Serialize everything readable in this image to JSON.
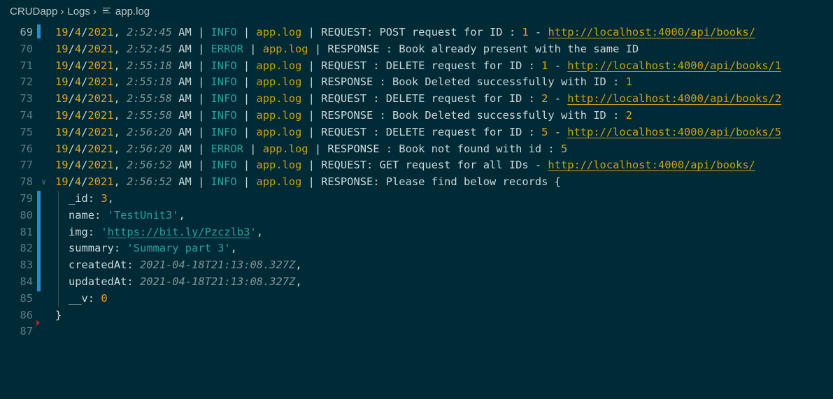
{
  "breadcrumb": {
    "project": "CRUDapp",
    "folder": "Logs",
    "file": "app.log"
  },
  "lines": [
    {
      "n": "69",
      "date": "19/4/2021",
      "time": "2:52:45",
      "ampm": "AM",
      "level": "INFO",
      "file": "app.log",
      "msg": "REQUEST: POST request for ID : ",
      "id": "1",
      "dash": " - ",
      "url": "http://localhost:4000/api/books/"
    },
    {
      "n": "70",
      "date": "19/4/2021",
      "time": "2:52:45",
      "ampm": "AM",
      "level": "ERROR",
      "file": "app.log",
      "msg": "RESPONSE : Book already present with the same ID"
    },
    {
      "n": "71",
      "date": "19/4/2021",
      "time": "2:55:18",
      "ampm": "AM",
      "level": "INFO",
      "file": "app.log",
      "msg": "REQUEST : DELETE request for ID : ",
      "id": "1",
      "dash": " - ",
      "url": "http://localhost:4000/api/books/1"
    },
    {
      "n": "72",
      "date": "19/4/2021",
      "time": "2:55:18",
      "ampm": "AM",
      "level": "INFO",
      "file": "app.log",
      "msg": "RESPONSE : Book Deleted successfully with ID : ",
      "id": "1"
    },
    {
      "n": "73",
      "date": "19/4/2021",
      "time": "2:55:58",
      "ampm": "AM",
      "level": "INFO",
      "file": "app.log",
      "msg": "REQUEST : DELETE request for ID : ",
      "id": "2",
      "dash": " - ",
      "url": "http://localhost:4000/api/books/2"
    },
    {
      "n": "74",
      "date": "19/4/2021",
      "time": "2:55:58",
      "ampm": "AM",
      "level": "INFO",
      "file": "app.log",
      "msg": "RESPONSE : Book Deleted successfully with ID : ",
      "id": "2"
    },
    {
      "n": "75",
      "date": "19/4/2021",
      "time": "2:56:20",
      "ampm": "AM",
      "level": "INFO",
      "file": "app.log",
      "msg": "REQUEST : DELETE request for ID : ",
      "id": "5",
      "dash": " - ",
      "url": "http://localhost:4000/api/books/5"
    },
    {
      "n": "76",
      "date": "19/4/2021",
      "time": "2:56:20",
      "ampm": "AM",
      "level": "ERROR",
      "file": "app.log",
      "msg": "RESPONSE : Book not found with id : ",
      "id": "5"
    },
    {
      "n": "77",
      "date": "19/4/2021",
      "time": "2:56:52",
      "ampm": "AM",
      "level": "INFO",
      "file": "app.log",
      "msg": "REQUEST: GET request for all IDs - ",
      "url": "http://localhost:4000/api/books/"
    },
    {
      "n": "78",
      "date": "19/4/2021",
      "time": "2:56:52",
      "ampm": "AM",
      "level": "INFO",
      "file": "app.log",
      "msg": "RESPONSE: Please find below records {"
    }
  ],
  "record": {
    "l79": {
      "n": "79",
      "key": "_id: ",
      "val": "3",
      "tail": ","
    },
    "l80": {
      "n": "80",
      "key": "name: ",
      "val": "'TestUnit3'",
      "tail": ","
    },
    "l81": {
      "n": "81",
      "key": "img: ",
      "q1": "'",
      "val": "https://bit.ly/Pzczlb3",
      "q2": "'",
      "tail": ","
    },
    "l82": {
      "n": "82",
      "key": "summary: ",
      "val": "'Summary part 3'",
      "tail": ","
    },
    "l83": {
      "n": "83",
      "key": "createdAt: ",
      "val": "2021-04-18T21:13:08.327Z",
      "tail": ","
    },
    "l84": {
      "n": "84",
      "key": "updatedAt: ",
      "val": "2021-04-18T21:13:08.327Z",
      "tail": ","
    },
    "l85": {
      "n": "85",
      "key": "__v: ",
      "val": "0"
    },
    "l86": {
      "n": "86",
      "text": "}"
    },
    "l87": {
      "n": "87"
    }
  },
  "separator": " | ",
  "colors": {
    "background": "#002b36",
    "number": "#e6a41b",
    "level": "#2aa198",
    "link": "#c9a015",
    "modified_gutter": "#268bd2"
  }
}
